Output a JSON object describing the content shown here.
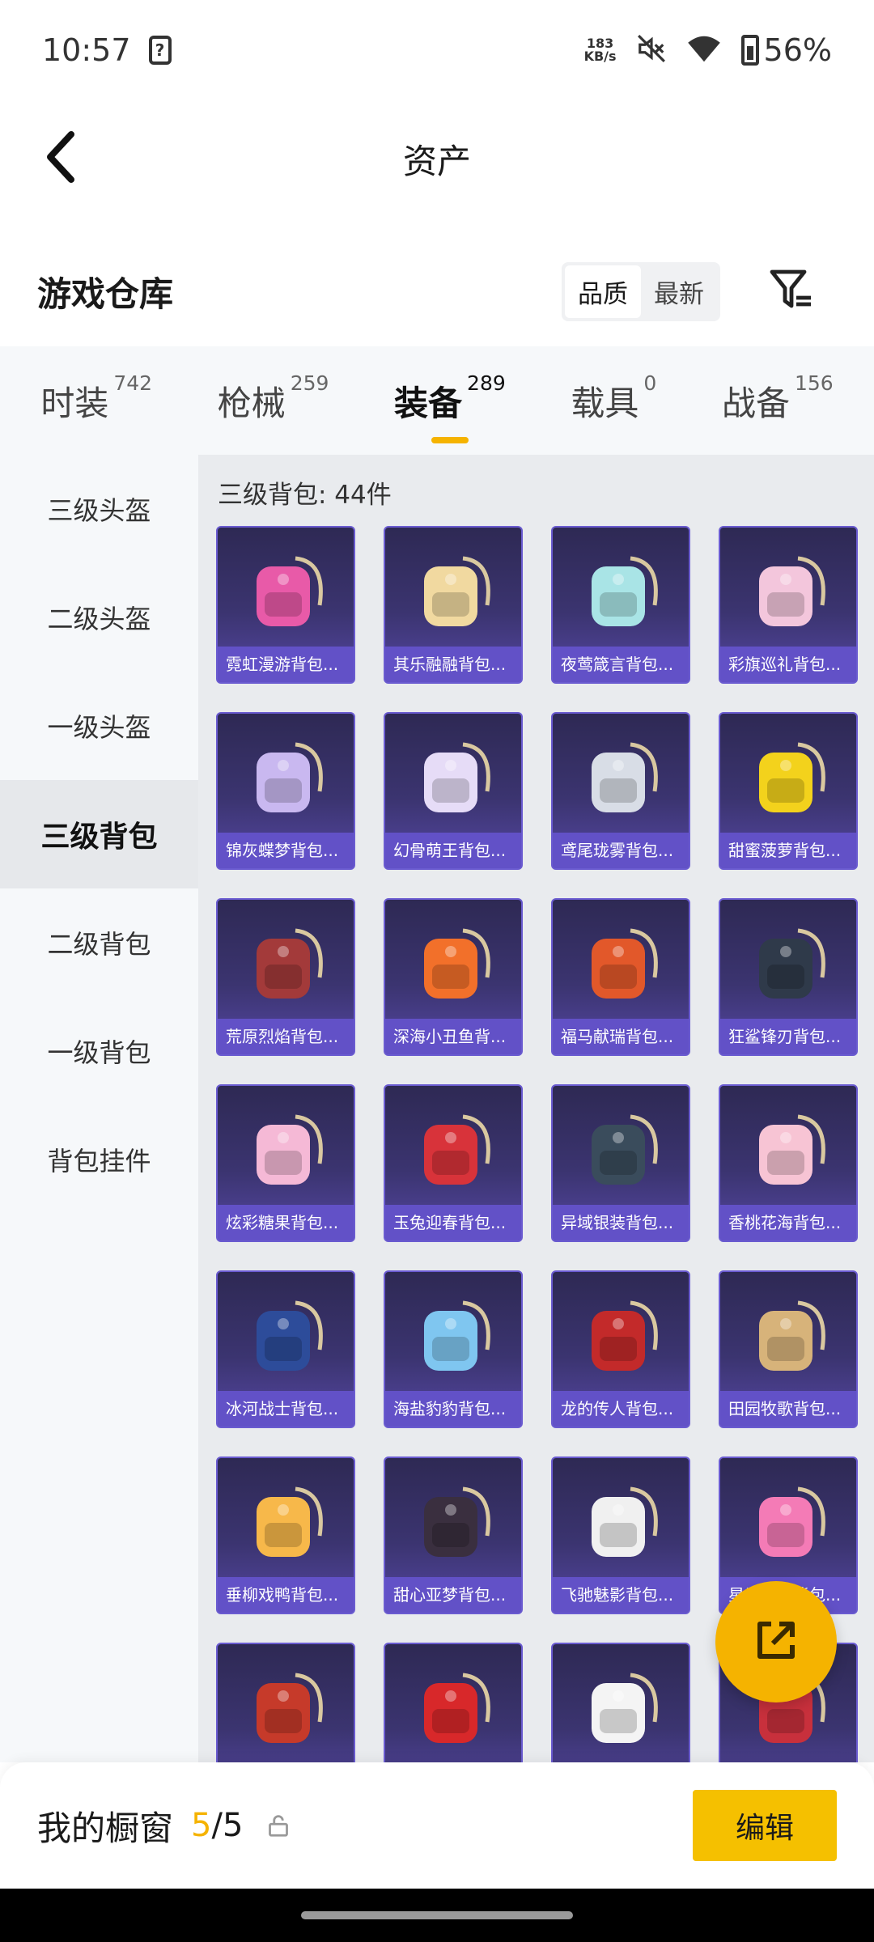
{
  "status_bar": {
    "time": "10:57",
    "net_speed_value": "183",
    "net_speed_unit": "KB/s",
    "battery": "56%",
    "icons": [
      "sim-question-icon",
      "mute-icon",
      "wifi-icon",
      "battery-charging-icon"
    ]
  },
  "header": {
    "title": "资产",
    "back_icon": "back-arrow-icon"
  },
  "section": {
    "title": "游戏仓库",
    "sort_options": [
      "品质",
      "最新"
    ],
    "sort_selected": "品质",
    "filter_icon": "filter-icon"
  },
  "tabs": [
    {
      "label": "时装",
      "count": "742"
    },
    {
      "label": "枪械",
      "count": "259"
    },
    {
      "label": "装备",
      "count": "289",
      "active": true
    },
    {
      "label": "载具",
      "count": "0"
    },
    {
      "label": "战备",
      "count": "156"
    }
  ],
  "sidebar": {
    "items": [
      "三级头盔",
      "二级头盔",
      "一级头盔",
      "三级背包",
      "二级背包",
      "一级背包",
      "背包挂件"
    ],
    "active": "三级背包"
  },
  "grid": {
    "count_label": "三级背包: 44件",
    "items": [
      {
        "name": "霓虹漫游背包...",
        "color": "#e85aa8"
      },
      {
        "name": "其乐融融背包...",
        "color": "#f1d9a0"
      },
      {
        "name": "夜莺箴言背包...",
        "color": "#a9e4e6"
      },
      {
        "name": "彩旗巡礼背包...",
        "color": "#f3c6dc"
      },
      {
        "name": "锦灰蝶梦背包...",
        "color": "#c9b8f0"
      },
      {
        "name": "幻骨萌王背包...",
        "color": "#e6dcf7"
      },
      {
        "name": "鸢尾珑雾背包...",
        "color": "#d8dde6"
      },
      {
        "name": "甜蜜菠萝背包...",
        "color": "#f3d21c"
      },
      {
        "name": "荒原烈焰背包...",
        "color": "#a33a3a"
      },
      {
        "name": "深海小丑鱼背...",
        "color": "#f2702a"
      },
      {
        "name": "福马献瑞背包...",
        "color": "#e2582a"
      },
      {
        "name": "狂鲨锋刃背包...",
        "color": "#2f3a4a"
      },
      {
        "name": "炫彩糖果背包...",
        "color": "#f5b9d6"
      },
      {
        "name": "玉兔迎春背包...",
        "color": "#d8333a"
      },
      {
        "name": "异域银装背包...",
        "color": "#3a4c5c"
      },
      {
        "name": "香桃花海背包...",
        "color": "#f7c4d4"
      },
      {
        "name": "冰河战士背包...",
        "color": "#2d4c9a"
      },
      {
        "name": "海盐豹豹背包...",
        "color": "#7fc6f0"
      },
      {
        "name": "龙的传人背包...",
        "color": "#c32a2a"
      },
      {
        "name": "田园牧歌背包...",
        "color": "#d7b37a"
      },
      {
        "name": "垂柳戏鸭背包...",
        "color": "#f7b84a"
      },
      {
        "name": "甜心亚梦背包...",
        "color": "#3a2f3f"
      },
      {
        "name": "飞驰魅影背包...",
        "color": "#f0f0f0"
      },
      {
        "name": "星光偶像背包...",
        "color": "#f47bb6"
      },
      {
        "name": "",
        "color": "#c63a2a"
      },
      {
        "name": "",
        "color": "#d8282a"
      },
      {
        "name": "",
        "color": "#f4f4f4"
      },
      {
        "name": "",
        "color": "#c8303c"
      }
    ]
  },
  "fab": {
    "icon": "share-external-icon"
  },
  "bottom_bar": {
    "label": "我的橱窗",
    "count_current": "5",
    "count_sep": "/",
    "count_total": "5",
    "lock_icon": "lock-icon",
    "edit_label": "编辑"
  }
}
